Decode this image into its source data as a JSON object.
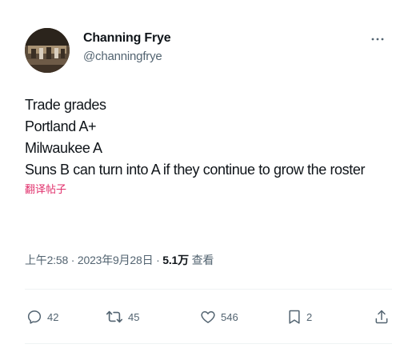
{
  "author": {
    "display_name": "Channing Frye",
    "handle": "@channingfrye"
  },
  "more_menu": {
    "icon": "more-horizontal-icon",
    "glyph": "···"
  },
  "tweet": {
    "lines": [
      "Trade grades",
      "Portland A+",
      "Milwaukee A",
      "Suns B can turn into A if they continue to grow the roster"
    ],
    "translate_label": "翻译帖子"
  },
  "meta": {
    "time": "上午2:58",
    "separator": " · ",
    "date": "2023年9月28日",
    "views_count": "5.1万",
    "views_label": " 查看"
  },
  "actions": {
    "reply": {
      "icon": "reply-icon",
      "count": "42"
    },
    "retweet": {
      "icon": "retweet-icon",
      "count": "45"
    },
    "like": {
      "icon": "heart-icon",
      "count": "546"
    },
    "bookmark": {
      "icon": "bookmark-icon",
      "count": "2"
    },
    "share": {
      "icon": "share-icon"
    }
  },
  "colors": {
    "text_primary": "#0f1419",
    "text_secondary": "#536471",
    "translate_link": "#e1306c",
    "divider": "#eff3f4"
  }
}
